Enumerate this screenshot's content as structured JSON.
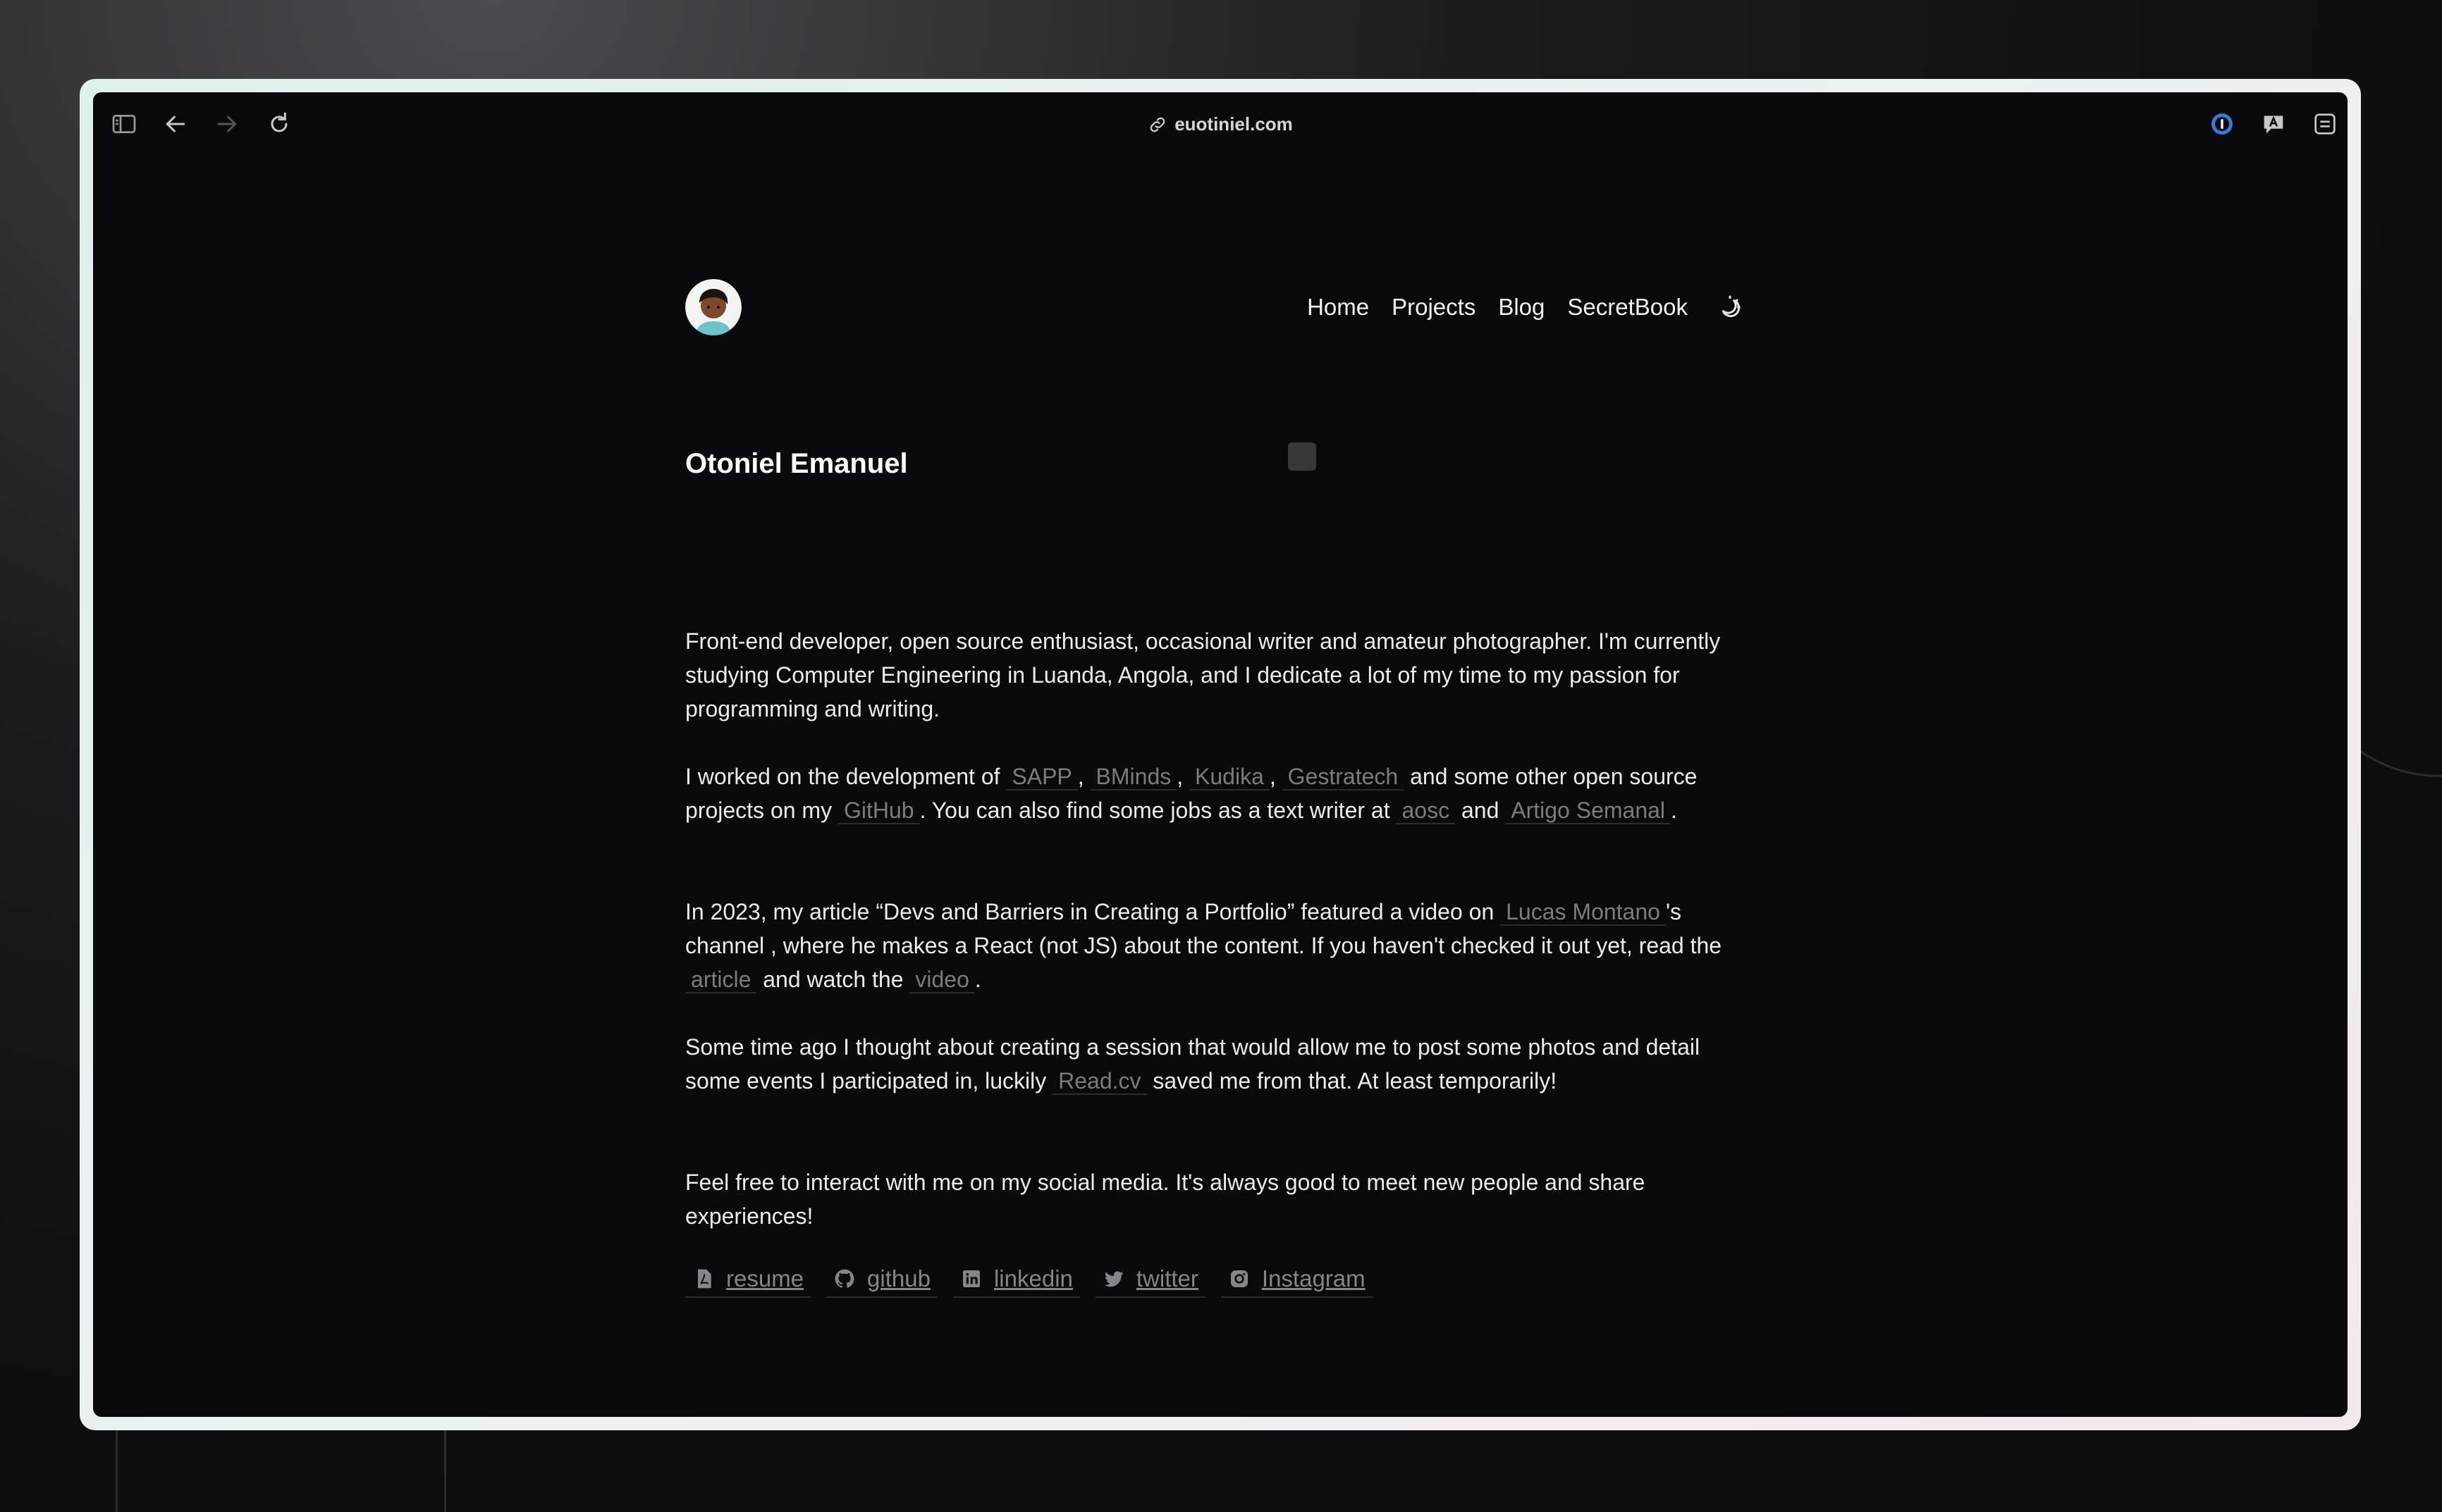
{
  "browser": {
    "url": "euotiniel.com"
  },
  "nav": {
    "items": [
      "Home",
      "Projects",
      "Blog",
      "SecretBook"
    ]
  },
  "profile": {
    "name": "Otoniel Emanuel"
  },
  "intro": {
    "p1": "Front-end developer, open source enthusiast, occasional writer and amateur photographer. I'm currently studying Computer Engineering in Luanda, Angola, and I dedicate a lot of my time to my passion for programming and writing.",
    "p2": {
      "t1": "I worked on the development of ",
      "l1": "SAPP",
      "t2": ", ",
      "l2": "BMinds",
      "t3": ", ",
      "l3": "Kudika",
      "t4": ", ",
      "l4": "Gestratech",
      "t5": " and some other open source projects on my ",
      "l5": "GitHub",
      "t6": ". You can also find some jobs as a text writer at ",
      "l6": "aosc",
      "t7": " and ",
      "l7": "Artigo Semanal",
      "t8": "."
    },
    "p3": {
      "t1": "In 2023, my article “Devs and Barriers in Creating a Portfolio” featured a video on ",
      "l1": "Lucas Montano",
      "t2": "'s channel , where he makes a React (not JS) about the content. If you haven't checked it out yet, read the ",
      "l2": "article",
      "t3": " and watch the ",
      "l3": "video",
      "t4": "."
    },
    "p4": {
      "t1": "Some time ago I thought about creating a session that would allow me to post some photos and detail some events I participated in, luckily ",
      "l1": "Read.cv",
      "t2": " saved me from that. At least temporarily!"
    },
    "p5": "Feel free to interact with me on my social media. It's always good to meet new people and share experiences!"
  },
  "socials": [
    {
      "label": "resume",
      "icon": "pdf-icon"
    },
    {
      "label": "github",
      "icon": "github-icon"
    },
    {
      "label": "linkedin",
      "icon": "linkedin-icon"
    },
    {
      "label": "twitter",
      "icon": "twitter-icon"
    },
    {
      "label": "Instagram",
      "icon": "instagram-icon"
    }
  ],
  "colors": {
    "background": "#0a0a0c",
    "text": "#ececee",
    "link": "#7b7b82"
  }
}
